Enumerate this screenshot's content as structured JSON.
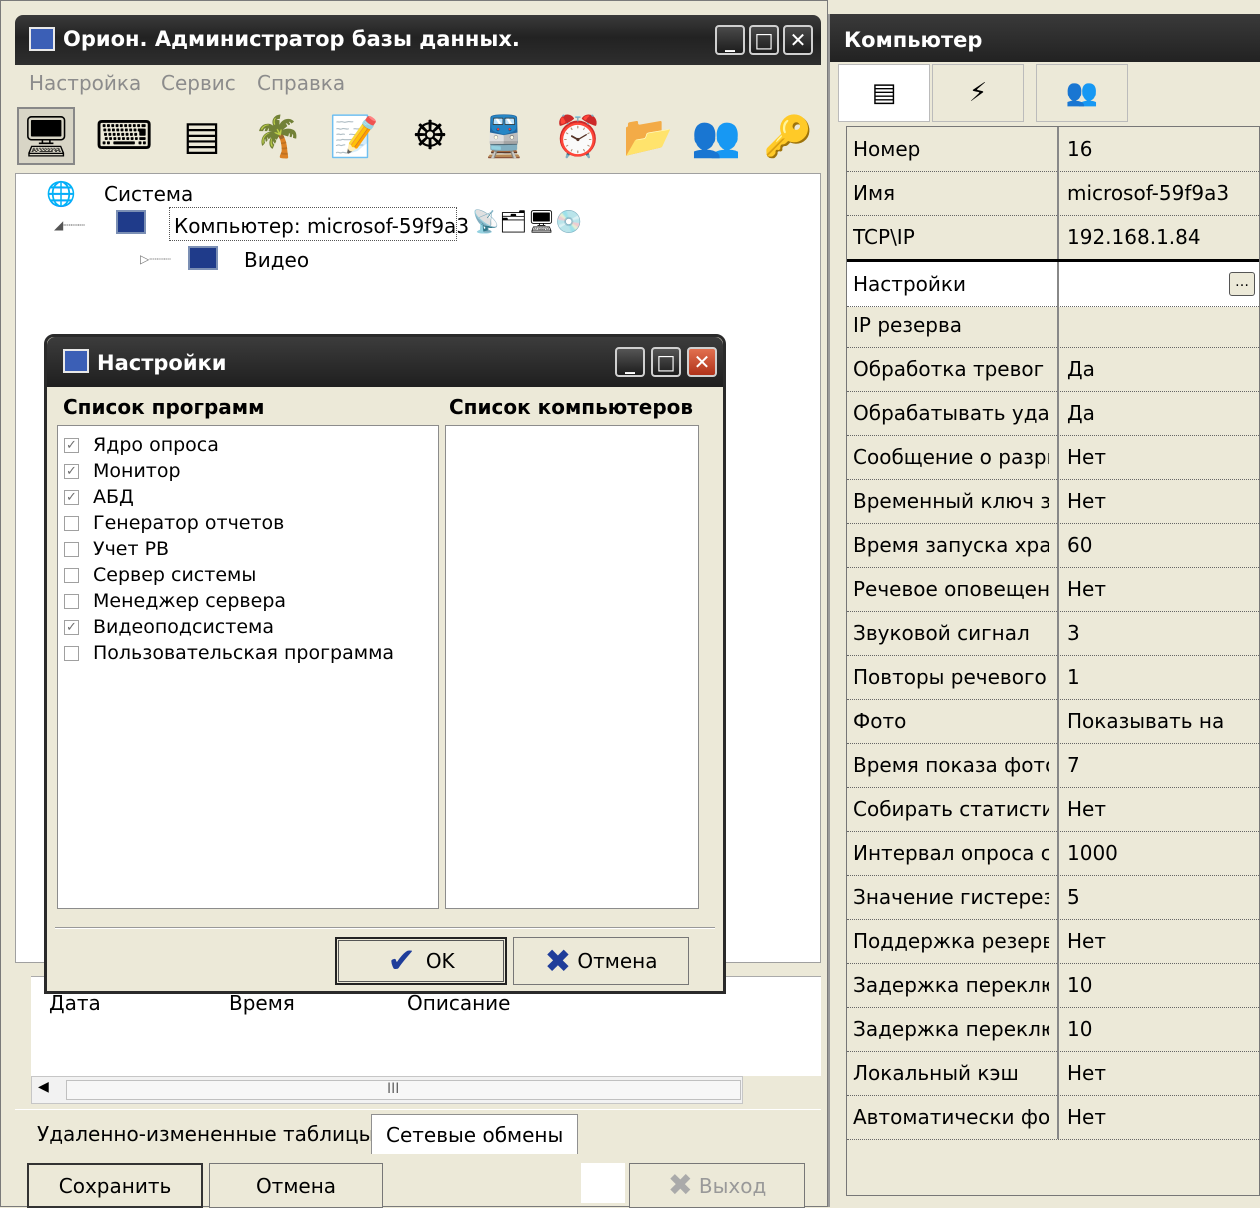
{
  "main_window": {
    "title": "Орион. Администратор базы данных.",
    "menu": [
      "Настройка",
      "Сервис",
      "Справка"
    ],
    "toolbar_icons": [
      "devices-icon",
      "keyboard-icon",
      "controller-icon",
      "palm-icon",
      "note-icon",
      "wheel-icon",
      "train-icon",
      "schedule-icon",
      "folder-users-icon",
      "users-icon",
      "user-key-icon"
    ],
    "tree": {
      "root": "Система",
      "computer": "Компьютер: microsof-59f9a3",
      "child": "Видео"
    },
    "log_columns": [
      "Дата",
      "Время",
      "Описание"
    ],
    "scroll_thumb_glyph": "III",
    "tabs": [
      "Удаленно-измененные таблицы",
      "Сетевые обмены"
    ],
    "buttons": {
      "save": "Сохранить",
      "cancel": "Отмена",
      "exit": "Выход"
    }
  },
  "dialog": {
    "title": "Настройки",
    "programs_header": "Список программ",
    "computers_header": "Список компьютеров",
    "programs": [
      {
        "label": "Ядро опроса",
        "checked": true
      },
      {
        "label": "Монитор",
        "checked": true
      },
      {
        "label": "АБД",
        "checked": true
      },
      {
        "label": "Генератор отчетов",
        "checked": false
      },
      {
        "label": "Учет РВ",
        "checked": false
      },
      {
        "label": "Сервер системы",
        "checked": false
      },
      {
        "label": "Менеджер сервера",
        "checked": false
      },
      {
        "label": "Видеоподсистема",
        "checked": true
      },
      {
        "label": "Пользовательская программа",
        "checked": false
      }
    ],
    "ok_label": "OK",
    "cancel_label": "Отмена"
  },
  "properties": {
    "title": "Компьютер",
    "tabs": [
      "list-icon",
      "lightning-icon",
      "users-key-icon"
    ],
    "rows": [
      {
        "name": "Номер",
        "value": "16"
      },
      {
        "name": "Имя",
        "value": "microsof-59f9a3"
      },
      {
        "name": "TCP\\IP",
        "value": "192.168.1.84"
      },
      {
        "name": "Настройки",
        "value": ""
      },
      {
        "name": "IP резерва",
        "value": ""
      },
      {
        "name": "Обработка тревог",
        "value": "Да"
      },
      {
        "name": "Обрабатывать удал",
        "value": "Да"
      },
      {
        "name": "Сообщение о разрь",
        "value": "Нет"
      },
      {
        "name": "Временный ключ за",
        "value": "Нет"
      },
      {
        "name": "Время запуска хран",
        "value": "60"
      },
      {
        "name": "Речевое оповещени",
        "value": "Нет"
      },
      {
        "name": "Звуковой сигнал",
        "value": "3"
      },
      {
        "name": "Повторы речевого о",
        "value": "1"
      },
      {
        "name": "Фото",
        "value": "Показывать на"
      },
      {
        "name": "Время показа фото",
        "value": "7"
      },
      {
        "name": "Собирать статистик",
        "value": "Нет"
      },
      {
        "name": "Интервал опроса ст",
        "value": "1000"
      },
      {
        "name": "Значение гистерези",
        "value": "5"
      },
      {
        "name": "Поддержка резерви",
        "value": "Нет"
      },
      {
        "name": "Задержка переключ",
        "value": "10"
      },
      {
        "name": "Задержка переключ",
        "value": "10"
      },
      {
        "name": "Локальный кэш",
        "value": "Нет"
      },
      {
        "name": "Автоматически фор",
        "value": "Нет"
      }
    ]
  }
}
